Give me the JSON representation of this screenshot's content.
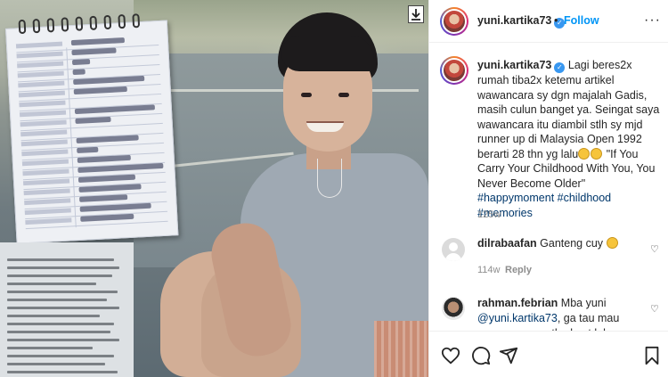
{
  "post": {
    "username": "yuni.kartika73",
    "follow_label": "Follow",
    "dot": "•",
    "more": "···",
    "caption_pre": "Lagi beres2x rumah tiba2x ketemu artikel wawancara sy dgn majalah Gadis, masih culun banget ya. Seingat saya wawancara itu diambil stlh sy mjd runner up di Malaysia Open 1992 berarti 28 thn yg lalu",
    "caption_post": " \"If You Carry Your Childhood With You, You Never Become Older\" ",
    "tags": [
      "#happymoment",
      "#childhood",
      "#memories"
    ],
    "caption_time": "125w"
  },
  "comments": [
    {
      "username": "dilrabaafan",
      "text": "Ganteng cuy",
      "time": "114w",
      "reply_label": "Reply"
    },
    {
      "username": "rahman.febrian",
      "text_pre": "Mba yuni",
      "mention": "@yuni.kartika73",
      "text_post": ", ga tau mau ngomong apa, the best lah"
    }
  ],
  "icons": {
    "download": "download-icon",
    "verified": "verified-badge-icon",
    "heart": "heart-icon",
    "comment": "comment-icon",
    "share": "share-icon",
    "save": "bookmark-icon"
  },
  "colors": {
    "follow": "#0095f6",
    "verified": "#3897f0",
    "hashtag": "#00376b",
    "muted": "#8e8e8e"
  }
}
